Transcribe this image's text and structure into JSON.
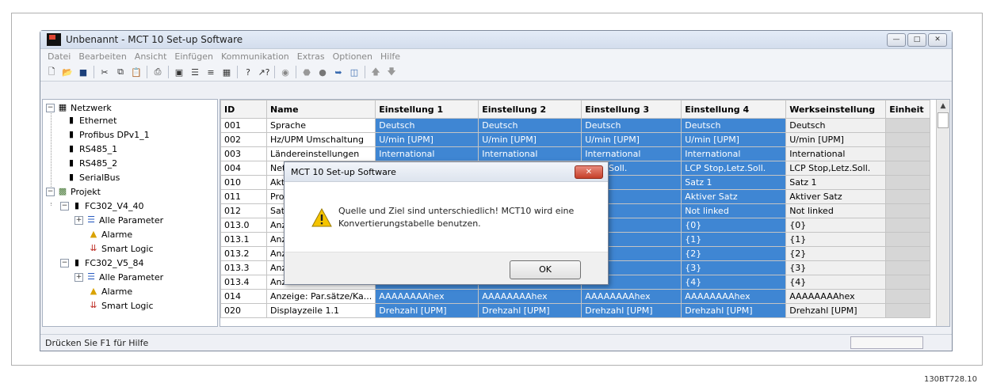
{
  "window": {
    "title": "Unbenannt - MCT 10 Set-up Software",
    "controls": [
      "minimize-icon",
      "maximize-icon",
      "close-icon"
    ]
  },
  "menu": [
    "Datei",
    "Bearbeiten",
    "Ansicht",
    "Einfügen",
    "Kommunikation",
    "Extras",
    "Optionen",
    "Hilfe"
  ],
  "toolbar_icons": [
    "new-icon",
    "open-icon",
    "save-icon",
    "cut-icon",
    "copy-icon",
    "paste-icon",
    "print-icon",
    "small-icons-icon",
    "list-icon",
    "details-icon",
    "grid-icon",
    "help-icon",
    "context-help-icon",
    "network-icon",
    "stop-icon",
    "record-icon",
    "write-icon",
    "read-icon",
    "up-icon",
    "down-icon"
  ],
  "tree": {
    "network": "Netzwerk",
    "ethernet": "Ethernet",
    "profibus": "Profibus DPv1_1",
    "rs485_1": "RS485_1",
    "rs485_2": "RS485_2",
    "serialbus": "SerialBus",
    "project": "Projekt",
    "drive1": "FC302_V4_40",
    "drive1_params": "Alle Parameter",
    "drive1_alarms": "Alarme",
    "drive1_logic": "Smart Logic",
    "drive2": "FC302_V5_84",
    "drive2_params": "Alle Parameter",
    "drive2_alarms": "Alarme",
    "drive2_logic": "Smart Logic"
  },
  "grid": {
    "headers": [
      "ID",
      "Name",
      "Einstellung 1",
      "Einstellung 2",
      "Einstellung 3",
      "Einstellung 4",
      "Werkseinstellung",
      "Einheit"
    ],
    "rows": [
      [
        "001",
        "Sprache",
        "Deutsch",
        "Deutsch",
        "Deutsch",
        "Deutsch",
        "Deutsch",
        ""
      ],
      [
        "002",
        "Hz/UPM Umschaltung",
        "U/min [UPM]",
        "U/min [UPM]",
        "U/min [UPM]",
        "U/min [UPM]",
        "U/min [UPM]",
        ""
      ],
      [
        "003",
        "Ländereinstellungen",
        "International",
        "International",
        "International",
        "International",
        "International",
        ""
      ],
      [
        "004",
        "Net",
        "",
        "",
        ",Letz.Soll.",
        "LCP Stop,Letz.Soll.",
        "LCP Stop,Letz.Soll.",
        ""
      ],
      [
        "010",
        "Akt",
        "",
        "",
        "",
        "Satz 1",
        "Satz 1",
        ""
      ],
      [
        "011",
        "Pro",
        "",
        "",
        "atz",
        "Aktiver Satz",
        "Aktiver Satz",
        ""
      ],
      [
        "012",
        "Sat",
        "",
        "",
        "ed",
        "Not linked",
        "Not linked",
        ""
      ],
      [
        "013.0",
        "Anz",
        "",
        "",
        "",
        "{0}",
        "{0}",
        ""
      ],
      [
        "013.1",
        "Anz",
        "",
        "",
        "",
        "{1}",
        "{1}",
        ""
      ],
      [
        "013.2",
        "Anz",
        "",
        "",
        "",
        "{2}",
        "{2}",
        ""
      ],
      [
        "013.3",
        "Anz",
        "",
        "",
        "",
        "{3}",
        "{3}",
        ""
      ],
      [
        "013.4",
        "Anz",
        "",
        "",
        "",
        "{4}",
        "{4}",
        ""
      ],
      [
        "014",
        "Anzeige: Par.sätze/Ka...",
        "AAAAAAAAhex",
        "AAAAAAAAhex",
        "AAAAAAAAhex",
        "AAAAAAAAhex",
        "AAAAAAAAhex",
        ""
      ],
      [
        "020",
        "Displayzeile 1.1",
        "Drehzahl [UPM]",
        "Drehzahl [UPM]",
        "Drehzahl [UPM]",
        "Drehzahl [UPM]",
        "Drehzahl [UPM]",
        ""
      ]
    ]
  },
  "status": {
    "text": "Drücken Sie F1 für Hilfe"
  },
  "dialog": {
    "title": "MCT 10 Set-up Software",
    "message_line1": "Quelle und Ziel sind unterschiedlich! MCT10 wird eine",
    "message_line2": "Konvertierungstabelle benutzen.",
    "ok_label": "OK",
    "icon": "warning-icon"
  },
  "figure_code": "130BT728.10",
  "colors": {
    "selection": "#3f86d3",
    "default_col": "#f0f0f0",
    "unit_col": "#d6d6d6"
  }
}
